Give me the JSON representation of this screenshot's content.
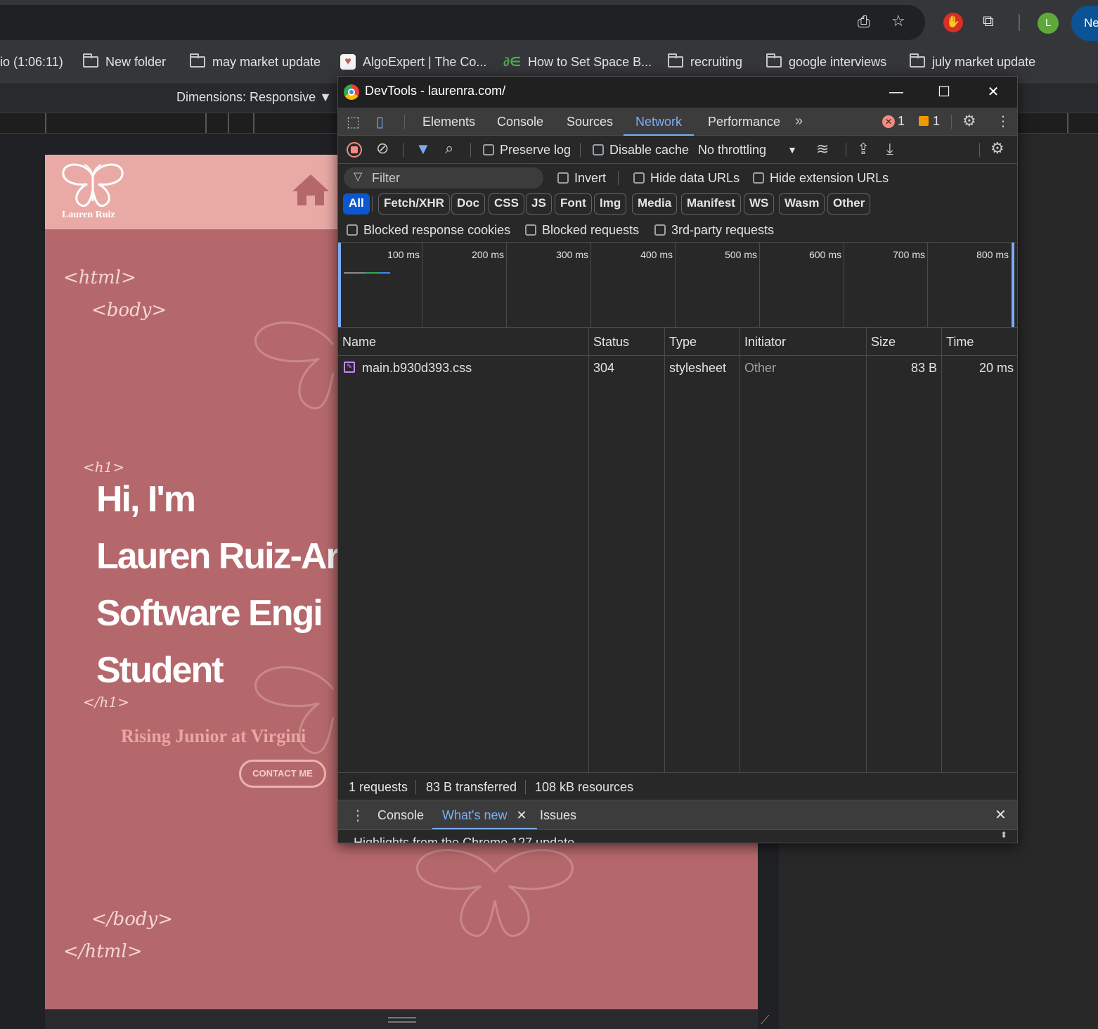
{
  "browser": {
    "bookmarks": [
      {
        "label": "io (1:06:11)",
        "icon": "none"
      },
      {
        "label": "New folder",
        "icon": "folder-icon"
      },
      {
        "label": "may market update",
        "icon": "folder-icon"
      },
      {
        "label": "AlgoExpert | The Co...",
        "icon": "heart-favicon"
      },
      {
        "label": "How to Set Space B...",
        "icon": "link-favicon"
      },
      {
        "label": "recruiting",
        "icon": "folder-icon"
      },
      {
        "label": "google interviews",
        "icon": "folder-icon"
      },
      {
        "label": "july market update",
        "icon": "folder-icon"
      }
    ],
    "avatar_letter": "L",
    "profile_label": "Ne",
    "device_toolbar": {
      "dimensions": "Dimensions: Responsive ▼"
    }
  },
  "page": {
    "logo_text": "Lauren Ruiz",
    "tags": {
      "html_open": "<html>",
      "body_open": "<body>",
      "h1_open": "<h1>",
      "h1_close": "</h1>",
      "body_close": "</body>",
      "html_close": "</html>"
    },
    "hero_lines": [
      "Hi, I'm",
      "Lauren Ruiz-Ar",
      "Software Engi",
      "Student"
    ],
    "subtitle": "Rising Junior at Virgini",
    "contact_button": "CONTACT ME",
    "colors": {
      "header_bg": "#e9aaa6",
      "body_bg": "#b5686c",
      "accent": "#e8a7a1"
    }
  },
  "devtools": {
    "title": "DevTools - laurenra.com/",
    "tabs": [
      "Elements",
      "Console",
      "Sources",
      "Network",
      "Performance"
    ],
    "active_tab": "Network",
    "error_count": "1",
    "warning_count": "1",
    "toolbar": {
      "preserve_log": "Preserve log",
      "disable_cache": "Disable cache",
      "throttling": "No throttling"
    },
    "filter": {
      "placeholder": "Filter",
      "invert": "Invert",
      "hide_data_urls": "Hide data URLs",
      "hide_extension_urls": "Hide extension URLs"
    },
    "type_filters": [
      "All",
      "Fetch/XHR",
      "Doc",
      "CSS",
      "JS",
      "Font",
      "Img",
      "Media",
      "Manifest",
      "WS",
      "Wasm",
      "Other"
    ],
    "active_type_filter": "All",
    "blocked_filters": [
      "Blocked response cookies",
      "Blocked requests",
      "3rd-party requests"
    ],
    "timeline_labels": [
      "100 ms",
      "200 ms",
      "300 ms",
      "400 ms",
      "500 ms",
      "600 ms",
      "700 ms",
      "800 ms"
    ],
    "columns": [
      "Name",
      "Status",
      "Type",
      "Initiator",
      "Size",
      "Time"
    ],
    "rows": [
      {
        "name": "main.b930d393.css",
        "status": "304",
        "type": "stylesheet",
        "initiator": "Other",
        "size": "83 B",
        "time": "20 ms"
      }
    ],
    "summary": {
      "requests": "1 requests",
      "transferred": "83 B transferred",
      "resources": "108 kB resources"
    },
    "drawer": {
      "tabs": [
        "Console",
        "What's new",
        "Issues"
      ],
      "active_tab": "What's new",
      "content_preview": "Highlights from the Chrome 127 update"
    }
  }
}
